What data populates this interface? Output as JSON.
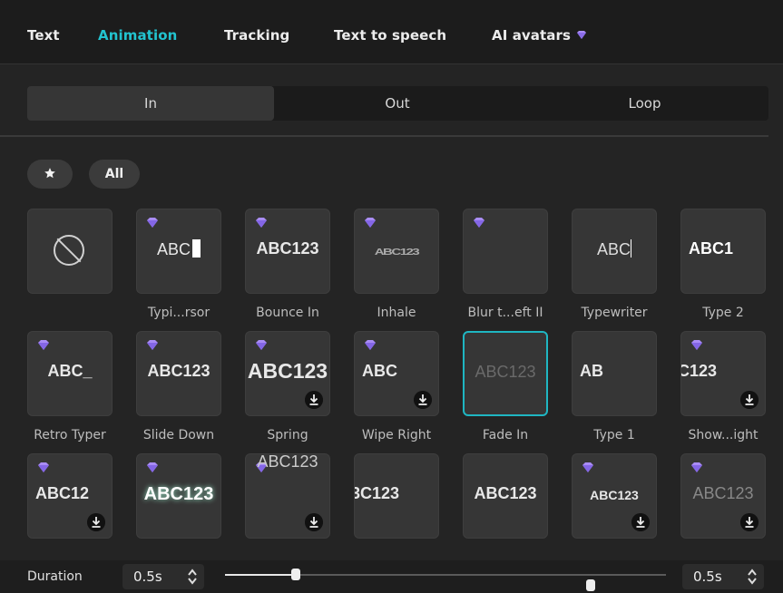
{
  "tabs": [
    {
      "label": "Text",
      "active": false,
      "premium": false
    },
    {
      "label": "Animation",
      "active": true,
      "premium": false
    },
    {
      "label": "Tracking",
      "active": false,
      "premium": false
    },
    {
      "label": "Text to speech",
      "active": false,
      "premium": false
    },
    {
      "label": "AI avatars",
      "active": false,
      "premium": true
    }
  ],
  "segments": [
    {
      "label": "In",
      "active": true
    },
    {
      "label": "Out",
      "active": false
    },
    {
      "label": "Loop",
      "active": false
    }
  ],
  "filters": {
    "favorites_icon": "star-icon",
    "all_label": "All"
  },
  "animations": [
    {
      "label": "",
      "preview": "",
      "premium": false,
      "download": false,
      "kind": "none"
    },
    {
      "label": "Typi...rsor",
      "preview": "ABC",
      "premium": true,
      "download": false,
      "kind": "cursor"
    },
    {
      "label": "Bounce In",
      "preview": "ABC123",
      "premium": true,
      "download": false
    },
    {
      "label": "Inhale",
      "preview": "ABC123",
      "premium": true,
      "download": false,
      "kind": "squeeze"
    },
    {
      "label": "Blur t...eft II",
      "preview": "",
      "premium": true,
      "download": false
    },
    {
      "label": "Typewriter",
      "preview": "ABC",
      "premium": false,
      "download": false,
      "kind": "typewriter"
    },
    {
      "label": "Type 2",
      "preview": "ABC1",
      "premium": false,
      "download": false,
      "kind": "fade-right"
    },
    {
      "label": "Retro Typer",
      "preview": "ABC_",
      "premium": true,
      "download": false
    },
    {
      "label": "Slide Down",
      "preview": "ABC123",
      "premium": true,
      "download": false
    },
    {
      "label": "Spring",
      "preview": "ABC123",
      "premium": true,
      "download": true,
      "kind": "large"
    },
    {
      "label": "Wipe Right",
      "preview": "ABC",
      "premium": true,
      "download": true,
      "kind": "left"
    },
    {
      "label": "Fade In",
      "preview": "ABC123",
      "premium": false,
      "download": false,
      "kind": "faded",
      "selected": true
    },
    {
      "label": "Type 1",
      "preview": "AB",
      "premium": false,
      "download": false,
      "kind": "left"
    },
    {
      "label": "Show...ight",
      "preview": "C123",
      "premium": true,
      "download": true,
      "kind": "left-cut"
    },
    {
      "label": "",
      "preview": "ABC12",
      "premium": true,
      "download": true,
      "kind": "left"
    },
    {
      "label": "",
      "preview": "ABC123",
      "premium": true,
      "download": false,
      "kind": "glow"
    },
    {
      "label": "",
      "preview": "ABC123",
      "premium": true,
      "download": true,
      "kind": "top-cut"
    },
    {
      "label": "",
      "preview": "3C123",
      "premium": false,
      "download": false,
      "kind": "left-cut"
    },
    {
      "label": "",
      "preview": "ABC123",
      "premium": false,
      "download": false
    },
    {
      "label": "",
      "preview": "ABC123",
      "premium": true,
      "download": true,
      "kind": "small"
    },
    {
      "label": "",
      "preview": "ABC123",
      "premium": true,
      "download": true,
      "kind": "partial"
    }
  ],
  "duration": {
    "label": "Duration",
    "in_value": "0.5s",
    "out_value": "0.5s",
    "in_fraction": 0.16,
    "out_fraction": 0.83
  },
  "colors": {
    "accent": "#22c3cf",
    "premium": "#a98cf5"
  }
}
